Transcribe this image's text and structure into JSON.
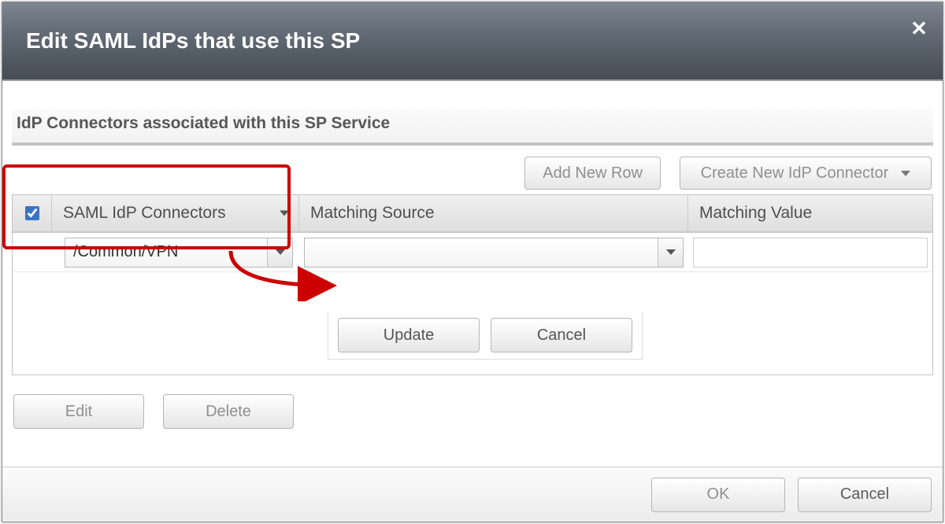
{
  "dialog": {
    "title": "Edit SAML IdPs that use this SP",
    "close_icon": "close"
  },
  "section": {
    "heading": "IdP Connectors associated with this SP Service"
  },
  "toolbar": {
    "add_row": "Add New Row",
    "create_connector": "Create New IdP Connector"
  },
  "grid": {
    "columns": {
      "connectors": "SAML IdP Connectors",
      "source": "Matching Source",
      "value": "Matching Value"
    },
    "rows": [
      {
        "checked": true,
        "connector": "/Common/VPN",
        "source": "",
        "value": ""
      }
    ]
  },
  "inline_actions": {
    "update": "Update",
    "cancel": "Cancel"
  },
  "bottom_actions": {
    "edit": "Edit",
    "delete": "Delete"
  },
  "footer": {
    "ok": "OK",
    "cancel": "Cancel"
  }
}
